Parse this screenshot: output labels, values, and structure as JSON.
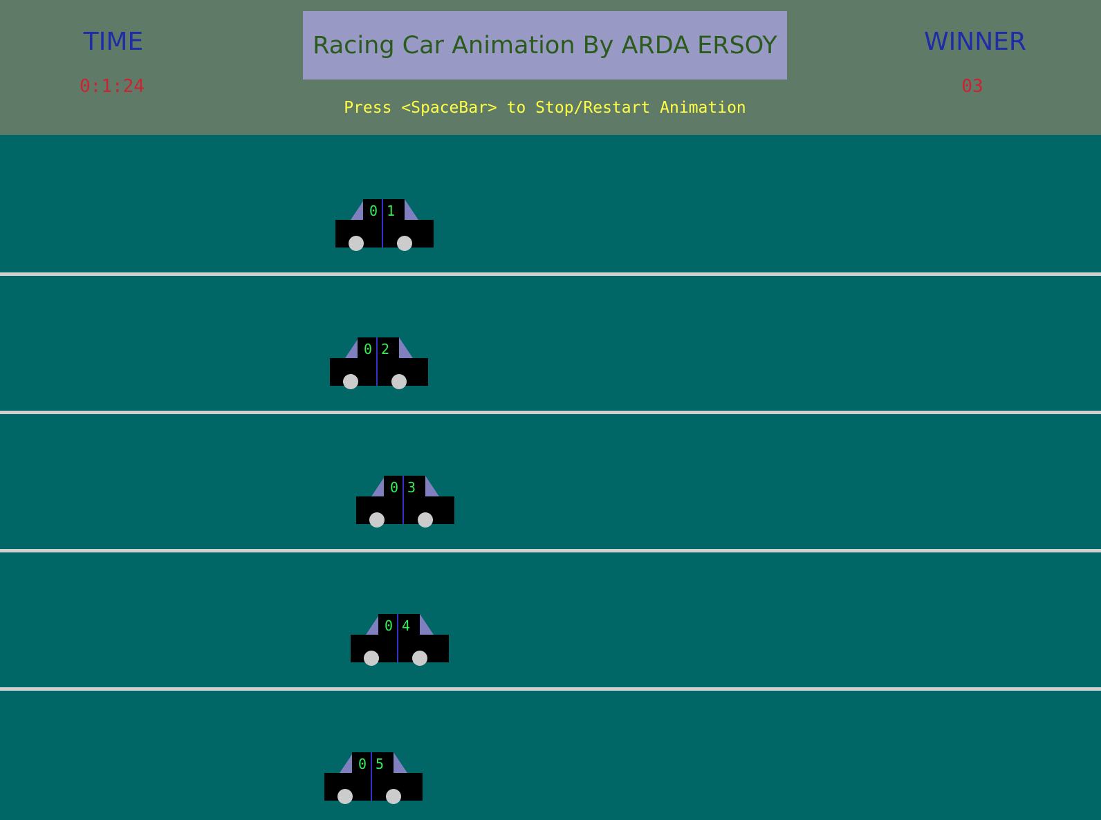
{
  "header": {
    "time_label": "TIME",
    "time_value": "0:1:24",
    "winner_label": "WINNER",
    "winner_value": "03",
    "title": "Racing Car Animation By ARDA ERSOY",
    "instruction": "Press <SpaceBar> to Stop/Restart Animation"
  },
  "colors": {
    "header_bg": "#5f7a66",
    "track_bg": "#006666",
    "title_box_bg": "#9999c6",
    "title_text": "#2b5b1c",
    "label_blue": "#1f2ca8",
    "value_red": "#cc2233",
    "instruction_yellow": "#ffff44",
    "lane_line": "#d0d0d0",
    "car_body": "#000000",
    "car_window": "#8080c0",
    "car_number": "#33ee55",
    "car_divider": "#3333cc",
    "wheel": "#cccccc"
  },
  "cars": [
    {
      "digit_a": "0",
      "digit_b": "1"
    },
    {
      "digit_a": "0",
      "digit_b": "2"
    },
    {
      "digit_a": "0",
      "digit_b": "3"
    },
    {
      "digit_a": "0",
      "digit_b": "4"
    },
    {
      "digit_a": "0",
      "digit_b": "5"
    }
  ]
}
